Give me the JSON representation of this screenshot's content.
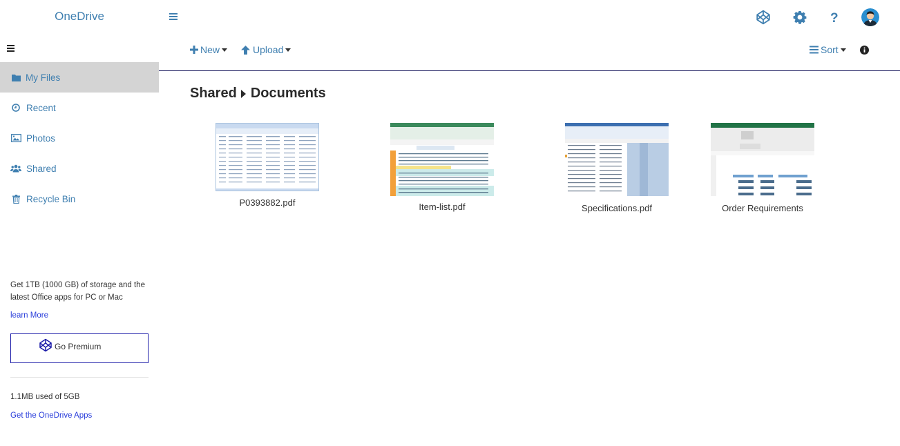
{
  "app": {
    "title": "OneDrive"
  },
  "sidebar": {
    "items": [
      {
        "label": "My Files",
        "icon": "folder-icon",
        "active": true
      },
      {
        "label": "Recent",
        "icon": "clock-icon",
        "active": false
      },
      {
        "label": "Photos",
        "icon": "image-icon",
        "active": false
      },
      {
        "label": "Shared",
        "icon": "users-icon",
        "active": false
      },
      {
        "label": "Recycle Bin",
        "icon": "trash-icon",
        "active": false
      }
    ],
    "promo_text": "Get 1TB (1000 GB) of storage and the latest Office apps for PC or Mac",
    "learn_more": "learn More",
    "premium_label": "Go Premium",
    "usage": "1.1MB used of 5GB",
    "apps_link": "Get the OneDrive Apps"
  },
  "toolbar": {
    "new_label": "New",
    "upload_label": "Upload",
    "sort_label": "Sort"
  },
  "breadcrumb": [
    "Shared",
    "Documents"
  ],
  "files": [
    {
      "name": "P0393882.pdf"
    },
    {
      "name": "Item-list.pdf"
    },
    {
      "name": "Specifications.pdf"
    },
    {
      "name": "Order Requirements"
    }
  ],
  "colors": {
    "accent": "#3f7fb0",
    "link": "#2b3fdb",
    "active_bg": "#d4d4d4"
  }
}
